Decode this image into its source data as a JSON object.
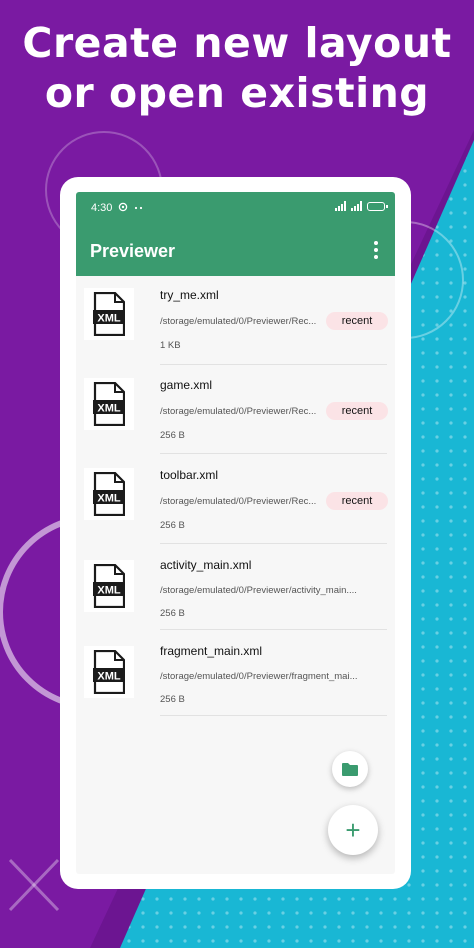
{
  "headline": {
    "line1": "Create new layout",
    "line2": "or open existing"
  },
  "colors": {
    "background_purple": "#7a1aa2",
    "background_cyan": "#19b7d4",
    "appbar_green": "#3a9b6f",
    "badge_pink": "#fbe3e6"
  },
  "statusbar": {
    "time": "4:30",
    "icons": [
      "sync-icon",
      "more-dots-icon",
      "signal-icon",
      "battery-icon"
    ]
  },
  "appbar": {
    "title": "Previewer",
    "menu_icon": "overflow-menu-icon"
  },
  "files": [
    {
      "name": "try_me.xml",
      "path": "/storage/emulated/0/Previewer/Rec...",
      "size": "1 KB",
      "badge": "recent",
      "icon": "xml-file-icon"
    },
    {
      "name": "game.xml",
      "path": "/storage/emulated/0/Previewer/Rec...",
      "size": "256 B",
      "badge": "recent",
      "icon": "xml-file-icon"
    },
    {
      "name": "toolbar.xml",
      "path": "/storage/emulated/0/Previewer/Rec...",
      "size": "256 B",
      "badge": "recent",
      "icon": "xml-file-icon"
    },
    {
      "name": "activity_main.xml",
      "path": "/storage/emulated/0/Previewer/activity_main....",
      "size": "256 B",
      "badge": "",
      "icon": "xml-file-icon"
    },
    {
      "name": "fragment_main.xml",
      "path": "/storage/emulated/0/Previewer/fragment_mai...",
      "size": "256 B",
      "badge": "",
      "icon": "xml-file-icon"
    }
  ],
  "fab": {
    "open_icon": "folder-icon",
    "new_label": "+"
  }
}
